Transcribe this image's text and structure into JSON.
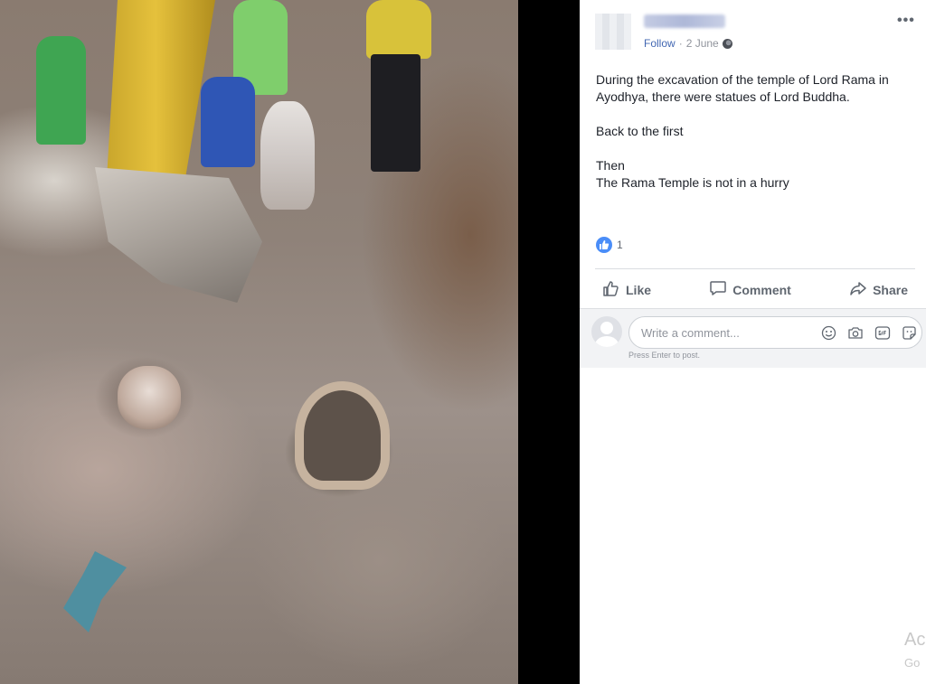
{
  "post": {
    "follow_label": "Follow",
    "separator": "·",
    "date": "2 June",
    "privacy_icon": "globe-icon",
    "more_label": "•••",
    "text": {
      "line1": "During the excavation of the temple of Lord Rama in Ayodhya, there were statues of Lord Buddha.",
      "line2": "Back to the first",
      "line3": "Then",
      "line4": "The Rama Temple is not in a hurry"
    },
    "reaction_count": "1",
    "reaction_icon": "like-reaction-icon"
  },
  "actions": {
    "like_label": "Like",
    "comment_label": "Comment",
    "share_label": "Share"
  },
  "comment_box": {
    "placeholder": "Write a comment...",
    "hint": "Press Enter to post."
  },
  "watermark": {
    "line1": "Ac",
    "line2": "Go"
  },
  "colors": {
    "link": "#4267b2",
    "muted_text": "#90949c",
    "action_text": "#606770",
    "like_blue": "#4a8df8"
  }
}
